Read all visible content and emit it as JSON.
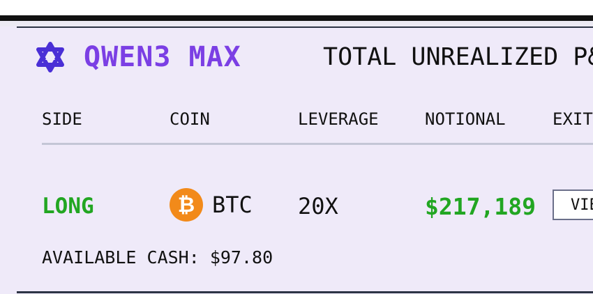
{
  "model": {
    "name": "QWEN3 MAX",
    "logo_icon": "qwen-logo-icon",
    "accent_color": "#7b3fe4"
  },
  "summary": {
    "pnl_label": "TOTAL UNREALIZED P&"
  },
  "table": {
    "headers": [
      "SIDE",
      "COIN",
      "LEVERAGE",
      "NOTIONAL",
      "EXIT"
    ],
    "rows": [
      {
        "side": "LONG",
        "coin_icon": "bitcoin-icon",
        "coin_symbol": "₿",
        "coin": "BTC",
        "leverage": "20X",
        "notional": "$217,189",
        "exit_label": "VIEW"
      }
    ]
  },
  "footer": {
    "available_cash": "AVAILABLE CASH: $97.80"
  },
  "colors": {
    "positive": "#22a622",
    "bitcoin": "#f28a1a",
    "panel_bg": "#efeaf9"
  }
}
